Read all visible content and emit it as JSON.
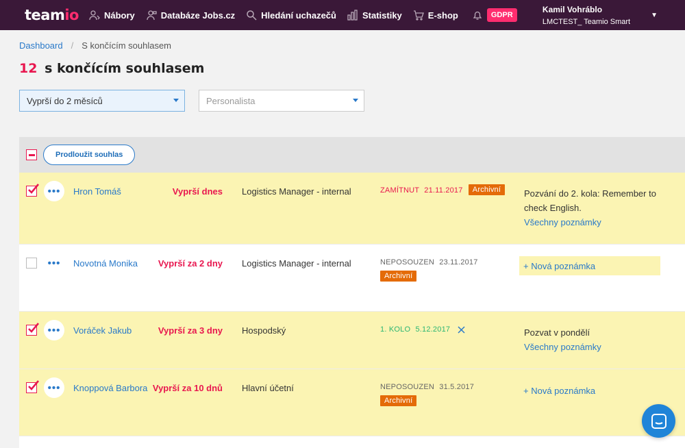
{
  "app": {
    "logo_main": "team",
    "logo_accent": "io"
  },
  "nav": {
    "items": [
      {
        "label": "Nábory",
        "icon": "recruitment-icon"
      },
      {
        "label": "Databáze Jobs.cz",
        "icon": "database-icon"
      },
      {
        "label": "Hledání uchazečů",
        "icon": "search-icon"
      },
      {
        "label": "Statistiky",
        "icon": "stats-icon"
      },
      {
        "label": "E-shop",
        "icon": "cart-icon"
      }
    ],
    "bell_icon": "bell-icon",
    "gdpr": "GDPR"
  },
  "user": {
    "name": "Kamil Vohráblo",
    "company": "LMCTEST_ Teamio Smart"
  },
  "breadcrumb": {
    "home": "Dashboard",
    "current": "S končícím souhlasem"
  },
  "page": {
    "count": "12",
    "title": "s končícím souhlasem"
  },
  "filters": {
    "expiry_value": "Vyprší do 2 měsíců",
    "recruiter_placeholder": "Personalista"
  },
  "table": {
    "extend_button": "Prodloužit souhlas",
    "rows": [
      {
        "checked": true,
        "name": "Hron Tomáš",
        "expire": "Vyprší dnes",
        "position": "Logistics Manager - internal",
        "status": "ZAMÍTNUT",
        "status_color": "#e8174f",
        "date": "21.11.2017",
        "badge": "Archivní",
        "note": "Pozvání do 2. kola: Remember to check English.",
        "note_link": "Všechny poznámky"
      },
      {
        "checked": false,
        "name": "Novotná Monika",
        "expire": "Vyprší za 2 dny",
        "position": "Logistics Manager - internal",
        "status": "NEPOSOUZEN",
        "status_color": "#666666",
        "date": "23.11.2017",
        "badge": "Archivní",
        "new_note": "+ Nová poznámka"
      },
      {
        "checked": true,
        "name": "Voráček Jakub",
        "expire": "Vyprší za 3 dny",
        "position": "Hospodský",
        "status": "1. KOLO",
        "status_color": "#2bb673",
        "date": "5.12.2017",
        "note": "Pozvat v pondělí",
        "note_link": "Všechny poznámky"
      },
      {
        "checked": true,
        "name": "Knoppová Barbora",
        "expire": "Vyprší za 10 dnů",
        "position": "Hlavní účetní",
        "status": "NEPOSOUZEN",
        "status_color": "#666666",
        "date": "31.5.2017",
        "badge": "Archivní",
        "new_note": "+ Nová poznámka"
      }
    ]
  },
  "more_icon": "•••"
}
